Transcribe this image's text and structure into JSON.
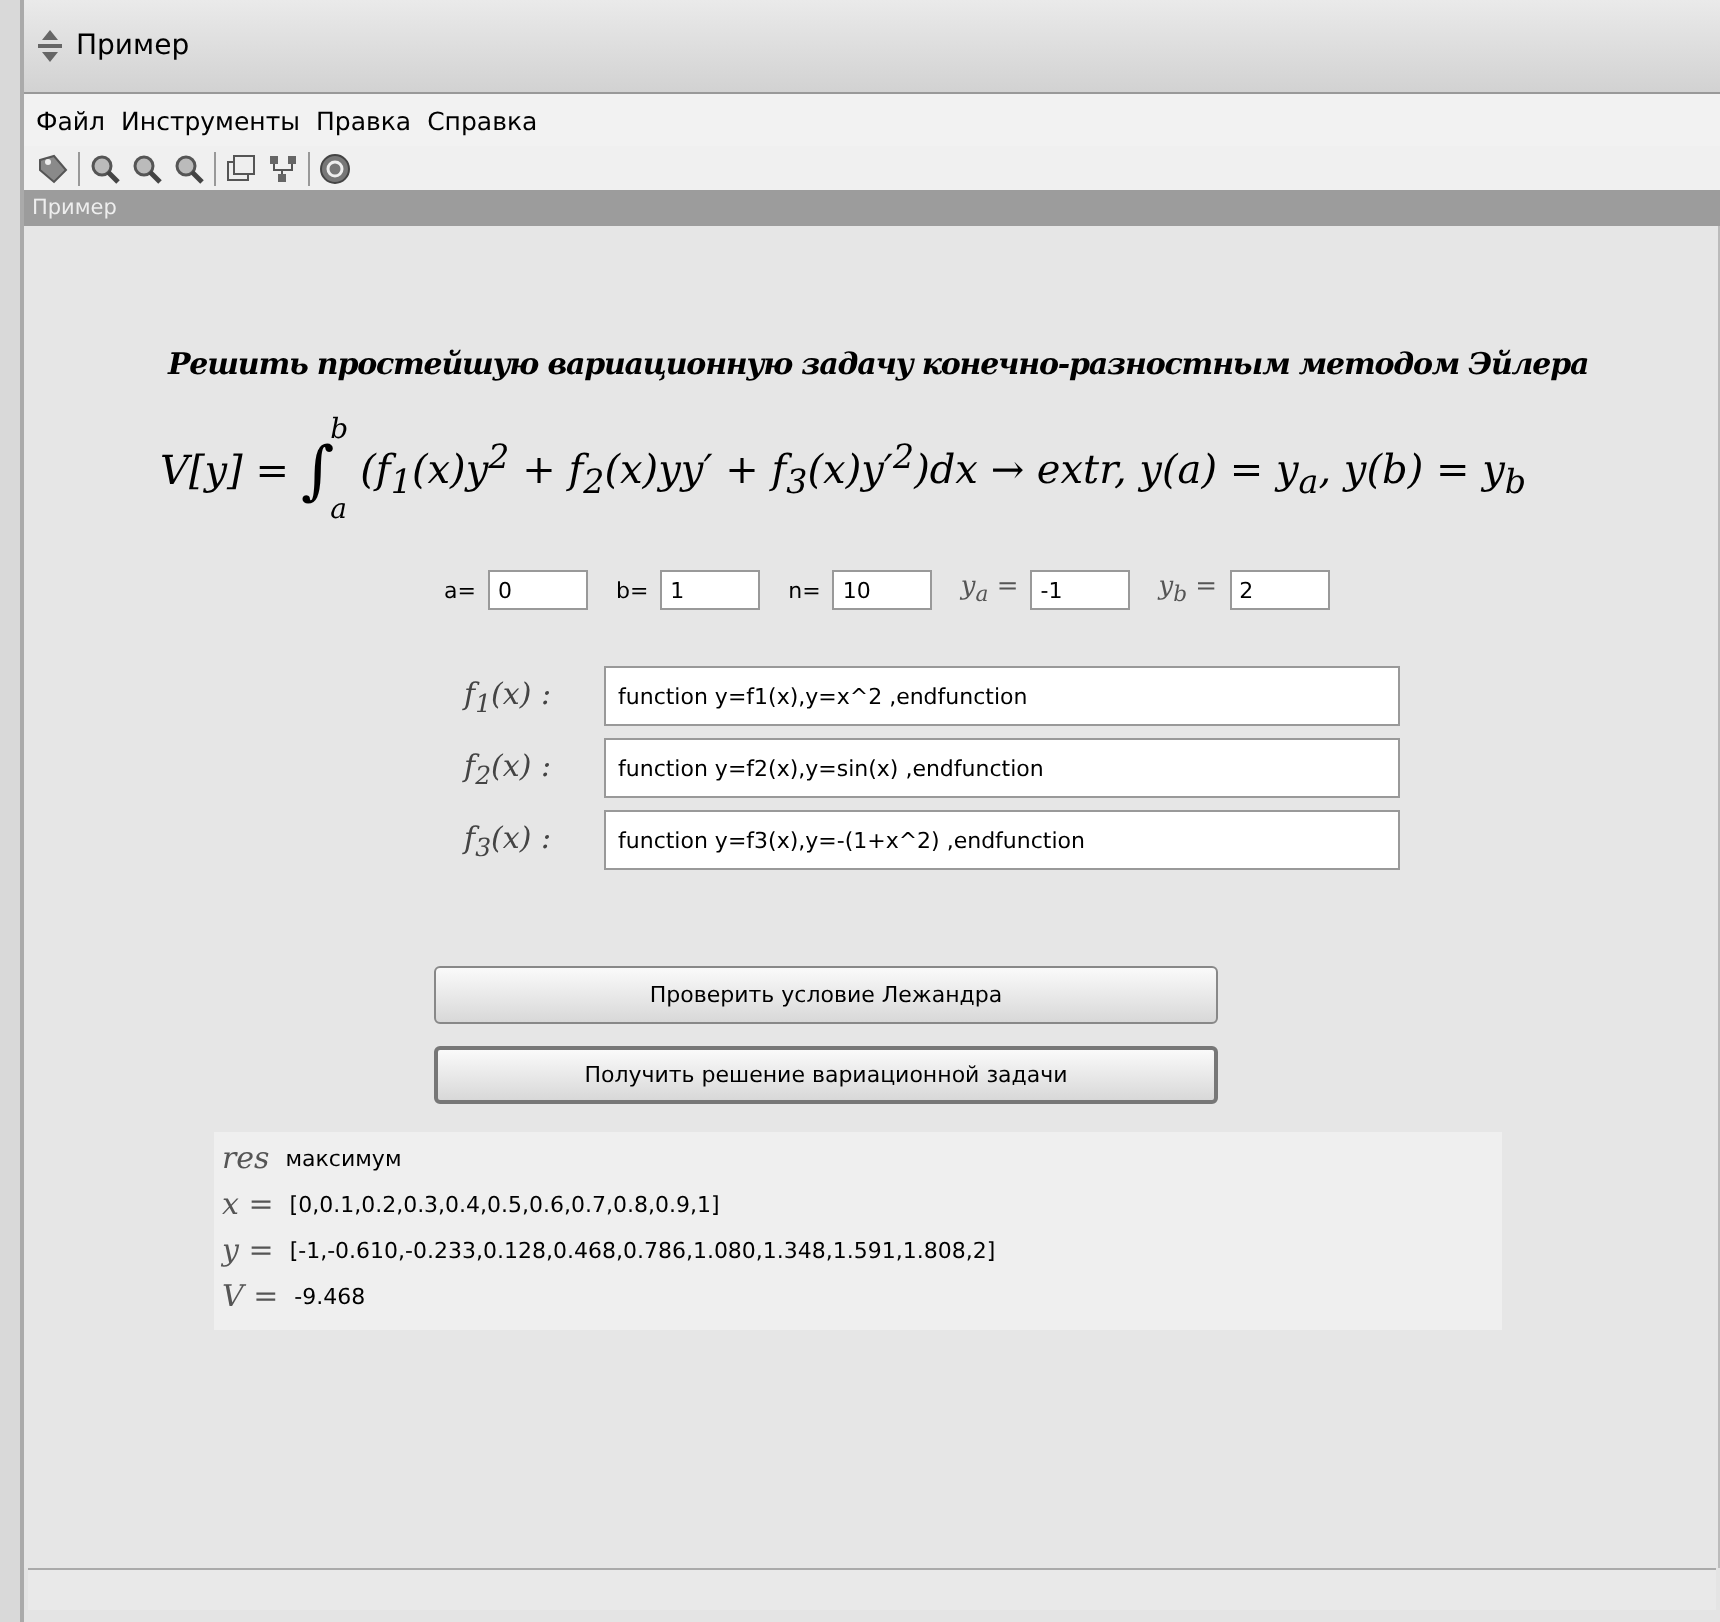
{
  "window": {
    "title": "Пример"
  },
  "menu": [
    "Файл",
    "Инструменты",
    "Правка",
    "Справка"
  ],
  "toolbar": [
    {
      "kind": "tag"
    },
    {
      "kind": "separator"
    },
    {
      "kind": "zoom"
    },
    {
      "kind": "zoom"
    },
    {
      "kind": "zoom"
    },
    {
      "kind": "separator"
    },
    {
      "kind": "windows"
    },
    {
      "kind": "tree"
    },
    {
      "kind": "separator"
    },
    {
      "kind": "help"
    }
  ],
  "subwindow": {
    "title": "Пример"
  },
  "heading": "Решить простейшую вариационную задачу конечно-разностным методом Эйлера",
  "formula": {
    "lhs": "V[y] =",
    "integral": "∫",
    "lower": "a",
    "upper": "b",
    "body": "(f$_{1}$(x)y$^{2}$ + f$_{2}$(x)yy′ + f$_{3}$(x)y′$^{2}$)dx → extr, y(a) = y$_{a}$, y(b) = y$_{b}$"
  },
  "params": [
    {
      "label": "a=",
      "kind": "plain",
      "value": "0"
    },
    {
      "label": "b=",
      "kind": "plain",
      "value": "1"
    },
    {
      "label": "n=",
      "kind": "plain",
      "value": "10"
    },
    {
      "label": "y$_{a}$ =",
      "kind": "math",
      "value": "-1"
    },
    {
      "label": "y$_{b}$ =",
      "kind": "math",
      "value": "2"
    }
  ],
  "functions": [
    {
      "label": "f$_{1}$(x) :",
      "value": "function y=f1(x),y=x^2 ,endfunction"
    },
    {
      "label": "f$_{2}$(x) :",
      "value": "function y=f2(x),y=sin(x) ,endfunction"
    },
    {
      "label": "f$_{3}$(x) :",
      "value": "function y=f3(x),y=-(1+x^2) ,endfunction"
    }
  ],
  "buttons": [
    {
      "label": "Проверить условие Лежандра",
      "focused": false
    },
    {
      "label": "Получить решение вариационной задачи",
      "focused": true
    }
  ],
  "results": [
    {
      "label": "res",
      "value": "максимум"
    },
    {
      "label": "x =",
      "value": "[0,0.1,0.2,0.3,0.4,0.5,0.6,0.7,0.8,0.9,1]"
    },
    {
      "label": "y =",
      "value": "[-1,-0.610,-0.233,0.128,0.468,0.786,1.080,1.348,1.591,1.808,2]"
    },
    {
      "label": "V =",
      "value": "-9.468"
    }
  ]
}
